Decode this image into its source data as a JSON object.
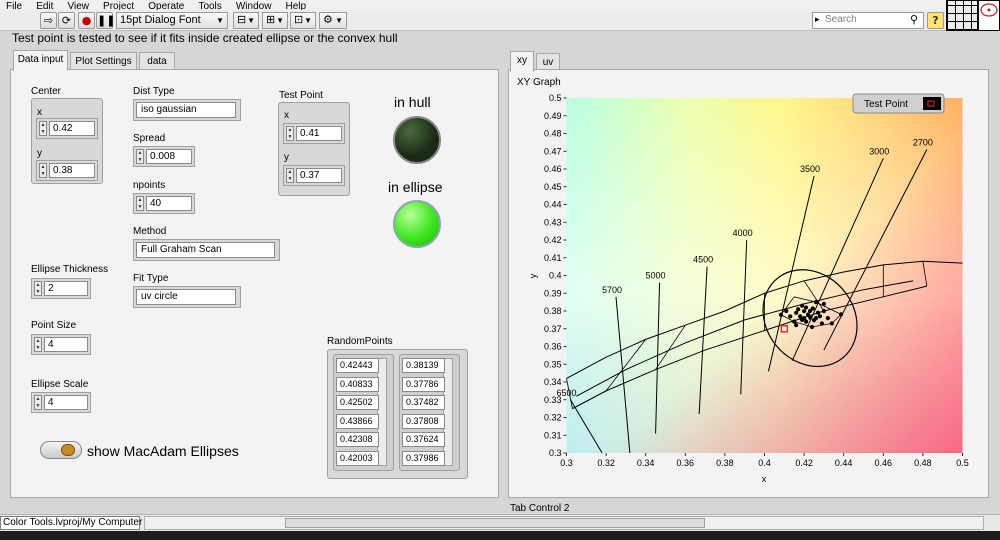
{
  "menu": [
    "File",
    "Edit",
    "View",
    "Project",
    "Operate",
    "Tools",
    "Window",
    "Help"
  ],
  "toolbar": {
    "font": "15pt Dialog Font",
    "search_placeholder": "Search",
    "help": "?"
  },
  "description": "Test point is tested to see if it fits inside created ellipse or the convex hull",
  "tabs_left": [
    "Data input",
    "Plot Settings",
    "data"
  ],
  "tabs_right": [
    "xy",
    "uv"
  ],
  "center": {
    "label": "Center",
    "x_label": "x",
    "x": "0.42",
    "y_label": "y",
    "y": "0.38"
  },
  "dist_type": {
    "label": "Dist Type",
    "value": "iso gaussian"
  },
  "spread": {
    "label": "Spread",
    "value": "0.008"
  },
  "npoints": {
    "label": "npoints",
    "value": "40"
  },
  "method": {
    "label": "Method",
    "value": "Full Graham Scan"
  },
  "fit_type": {
    "label": "Fit Type",
    "value": "uv circle"
  },
  "test_point": {
    "label": "Test Point",
    "x_label": "x",
    "x": "0.41",
    "y_label": "y",
    "y": "0.37"
  },
  "indicators": {
    "in_hull": {
      "label": "in hull",
      "state": "off",
      "color": "#1e3315"
    },
    "in_ellipse": {
      "label": "in ellipse",
      "state": "on",
      "color": "#3ee61e"
    }
  },
  "ellipse_thickness": {
    "label": "Ellipse Thickness",
    "value": "2"
  },
  "point_size": {
    "label": "Point Size",
    "value": "4"
  },
  "ellipse_scale": {
    "label": "Ellipse Scale",
    "value": "4"
  },
  "show_macadam": {
    "label": "show MacAdam Ellipses",
    "state": "off"
  },
  "random_points": {
    "label": "RandomPoints",
    "x": [
      "0.42443",
      "0.40833",
      "0.42502",
      "0.43866",
      "0.42308",
      "0.42003"
    ],
    "y": [
      "0.38139",
      "0.37786",
      "0.37482",
      "0.37808",
      "0.37624",
      "0.37986"
    ]
  },
  "tab_control_label": "Tab Control 2",
  "project": "Color Tools.lvproj/My Computer",
  "chart_data": {
    "type": "scatter",
    "title": "XY Graph",
    "xlabel": "x",
    "ylabel": "y",
    "xlim": [
      0.3,
      0.5
    ],
    "ylim": [
      0.3,
      0.5
    ],
    "x_ticks": [
      "0.3",
      "0.32",
      "0.34",
      "0.36",
      "0.38",
      "0.4",
      "0.42",
      "0.44",
      "0.46",
      "0.48",
      "0.5"
    ],
    "y_ticks": [
      "0.3",
      "0.31",
      "0.32",
      "0.33",
      "0.34",
      "0.35",
      "0.36",
      "0.37",
      "0.38",
      "0.39",
      "0.4",
      "0.41",
      "0.42",
      "0.43",
      "0.44",
      "0.45",
      "0.46",
      "0.47",
      "0.48",
      "0.49",
      "0.5"
    ],
    "legend": {
      "label": "Test Point",
      "position": "top-right"
    },
    "cct_labels": [
      "6500",
      "5700",
      "5000",
      "4500",
      "4000",
      "3500",
      "3000",
      "2700"
    ],
    "test_point": {
      "x": 0.41,
      "y": 0.37,
      "color": "#ff2020"
    },
    "ellipse": {
      "cx": 0.423,
      "cy": 0.376,
      "rx": 0.022,
      "ry": 0.029,
      "angle": -40
    },
    "points": [
      [
        0.4244,
        0.3814
      ],
      [
        0.4083,
        0.3779
      ],
      [
        0.425,
        0.3748
      ],
      [
        0.4387,
        0.3781
      ],
      [
        0.4231,
        0.3762
      ],
      [
        0.42,
        0.3799
      ],
      [
        0.418,
        0.377
      ],
      [
        0.421,
        0.374
      ],
      [
        0.416,
        0.379
      ],
      [
        0.428,
        0.377
      ],
      [
        0.419,
        0.383
      ],
      [
        0.424,
        0.371
      ],
      [
        0.43,
        0.38
      ],
      [
        0.415,
        0.374
      ],
      [
        0.426,
        0.385
      ],
      [
        0.417,
        0.381
      ],
      [
        0.422,
        0.378
      ],
      [
        0.429,
        0.373
      ],
      [
        0.413,
        0.377
      ],
      [
        0.432,
        0.376
      ],
      [
        0.42,
        0.376
      ],
      [
        0.423,
        0.38
      ],
      [
        0.426,
        0.376
      ],
      [
        0.411,
        0.38
      ],
      [
        0.434,
        0.373
      ],
      [
        0.419,
        0.375
      ],
      [
        0.427,
        0.379
      ],
      [
        0.416,
        0.372
      ],
      [
        0.421,
        0.382
      ],
      [
        0.43,
        0.384
      ]
    ],
    "hull": [
      [
        0.4083,
        0.3779
      ],
      [
        0.415,
        0.388
      ],
      [
        0.426,
        0.385
      ],
      [
        0.4387,
        0.3781
      ],
      [
        0.434,
        0.373
      ],
      [
        0.424,
        0.371
      ],
      [
        0.415,
        0.374
      ]
    ],
    "isotherms": [
      [
        [
          0.302,
          0.33
        ],
        [
          0.318,
          0.3
        ]
      ],
      [
        [
          0.325,
          0.388
        ],
        [
          0.332,
          0.3
        ]
      ],
      [
        [
          0.347,
          0.396
        ],
        [
          0.345,
          0.311
        ]
      ],
      [
        [
          0.371,
          0.405
        ],
        [
          0.367,
          0.322
        ]
      ],
      [
        [
          0.391,
          0.42
        ],
        [
          0.388,
          0.333
        ]
      ],
      [
        [
          0.425,
          0.456
        ],
        [
          0.402,
          0.346
        ]
      ],
      [
        [
          0.46,
          0.466
        ],
        [
          0.414,
          0.352
        ]
      ],
      [
        [
          0.482,
          0.471
        ],
        [
          0.43,
          0.358
        ]
      ]
    ],
    "locus_upper": [
      [
        0.3,
        0.342
      ],
      [
        0.32,
        0.354
      ],
      [
        0.34,
        0.364
      ],
      [
        0.36,
        0.372
      ],
      [
        0.38,
        0.38
      ],
      [
        0.4,
        0.39
      ],
      [
        0.42,
        0.397
      ],
      [
        0.44,
        0.402
      ],
      [
        0.46,
        0.406
      ],
      [
        0.48,
        0.408
      ],
      [
        0.5,
        0.407
      ]
    ],
    "locus_mid": [
      [
        0.305,
        0.332
      ],
      [
        0.33,
        0.347
      ],
      [
        0.36,
        0.362
      ],
      [
        0.39,
        0.375
      ],
      [
        0.42,
        0.384
      ],
      [
        0.45,
        0.392
      ],
      [
        0.475,
        0.397
      ]
    ],
    "locus_lower": [
      [
        0.303,
        0.325
      ],
      [
        0.32,
        0.335
      ],
      [
        0.345,
        0.347
      ],
      [
        0.37,
        0.358
      ],
      [
        0.4,
        0.369
      ],
      [
        0.43,
        0.38
      ],
      [
        0.46,
        0.388
      ],
      [
        0.482,
        0.394
      ]
    ]
  }
}
